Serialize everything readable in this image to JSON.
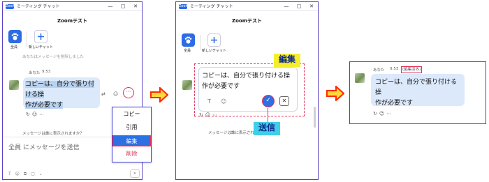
{
  "window": {
    "title": "ミーティング チャット",
    "app_icon": "Zoom",
    "minimize": "—",
    "maximize": "□",
    "close": "✕"
  },
  "chat": {
    "name": "Zoomテスト"
  },
  "apps": {
    "everyone_label": "全員",
    "new_chat_label": "新しいチャット"
  },
  "deleted_notice": "あなたはメッセージを削除しました",
  "message": {
    "sender": "あなた",
    "time": "9:53",
    "line1": "コピーは、自分で張り付ける操",
    "line2": "作が必要です",
    "edited_badge": "(編集済み)"
  },
  "who_can_see": "メッセージは誰に表示されますか？",
  "composer": {
    "placeholder": "全員 にメッセージを送信"
  },
  "menu": {
    "items": [
      "コピー",
      "引用",
      "編集",
      "削除"
    ]
  },
  "callouts": {
    "edit": "編集",
    "send": "送信"
  },
  "colors": {
    "accent": "#2f6fe0",
    "highlight": "#e0325a",
    "callout_bg": "#f5ee2e",
    "callout_send_bg": "#3fd0e8",
    "arrow": "#ff2a00",
    "bubble": "#dbe9fb",
    "window_border": "#5b3fc4"
  }
}
